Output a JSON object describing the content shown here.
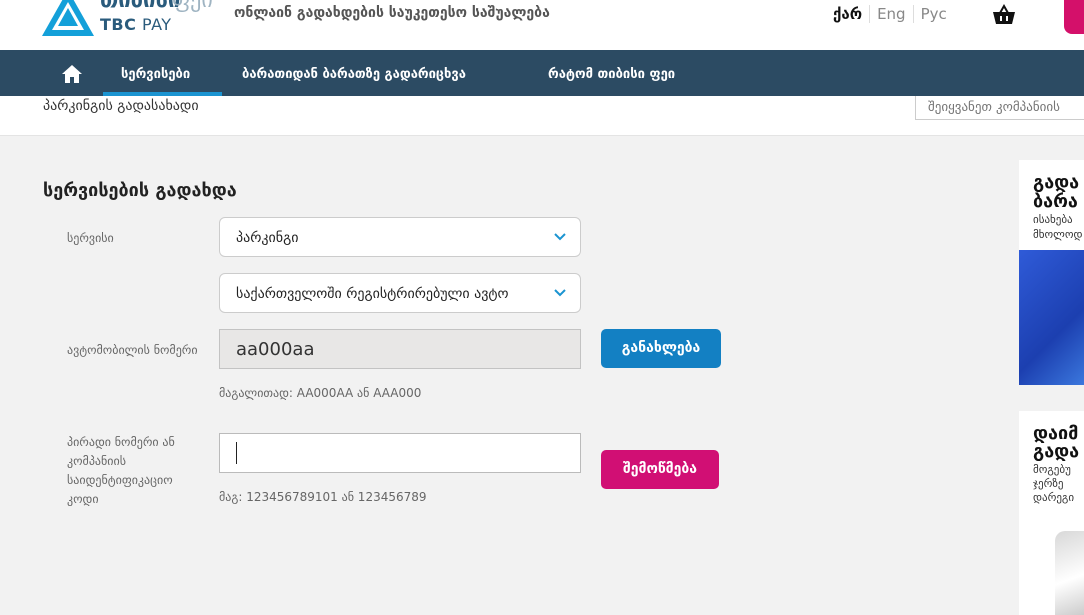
{
  "header": {
    "brand_geo": "თიბისი",
    "brand_geo_light": "ფეი",
    "brand_tbc": "TBC",
    "brand_pay": " PAY",
    "tagline": "ონლაინ გადახდების საუკეთესო საშუალება",
    "languages": [
      "ქარ",
      "Eng",
      "Рус"
    ]
  },
  "nav": {
    "items": [
      "სერვისები",
      "ბარათიდან ბარათზე გადარიცხვა",
      "რატომ თიბისი ფეი"
    ]
  },
  "breadcrumb": "პარკინგის გადასახადი",
  "company_search_placeholder": "შეიყვანეთ კომპანიის",
  "form": {
    "title": "სერვისების გადახდა",
    "service_label": "სერვისი",
    "service_value": "პარკინგი",
    "subservice_value": "საქართველოში რეგისტრირებული ავტო",
    "car_number_label": "ავტომობილის ნომერი",
    "car_number_value": "aa000aa",
    "update_button": "განახლება",
    "car_number_hint": "მაგალითად: AA000AA ან AAA000",
    "id_label": [
      "პირადი ნომერი ან",
      "კომპანიის",
      "საიდენტიფიკაციო",
      "კოდი"
    ],
    "check_button": "შემოწმება",
    "id_hint": "მაგ: 123456789101 ან 123456789"
  },
  "promos": [
    {
      "title": [
        "გადა",
        "ბარა"
      ],
      "text": [
        "ისახება",
        "მხოლოდ"
      ]
    },
    {
      "title": [
        "დაიმ",
        "გადა"
      ],
      "text": [
        "მოგებუ",
        "ჯერზე",
        "დარეგი"
      ]
    }
  ],
  "colors": {
    "nav_bg": "#2c4b63",
    "accent_blue": "#1380c3",
    "accent_pink": "#d10f74",
    "nav_active": "#1b94d1"
  }
}
